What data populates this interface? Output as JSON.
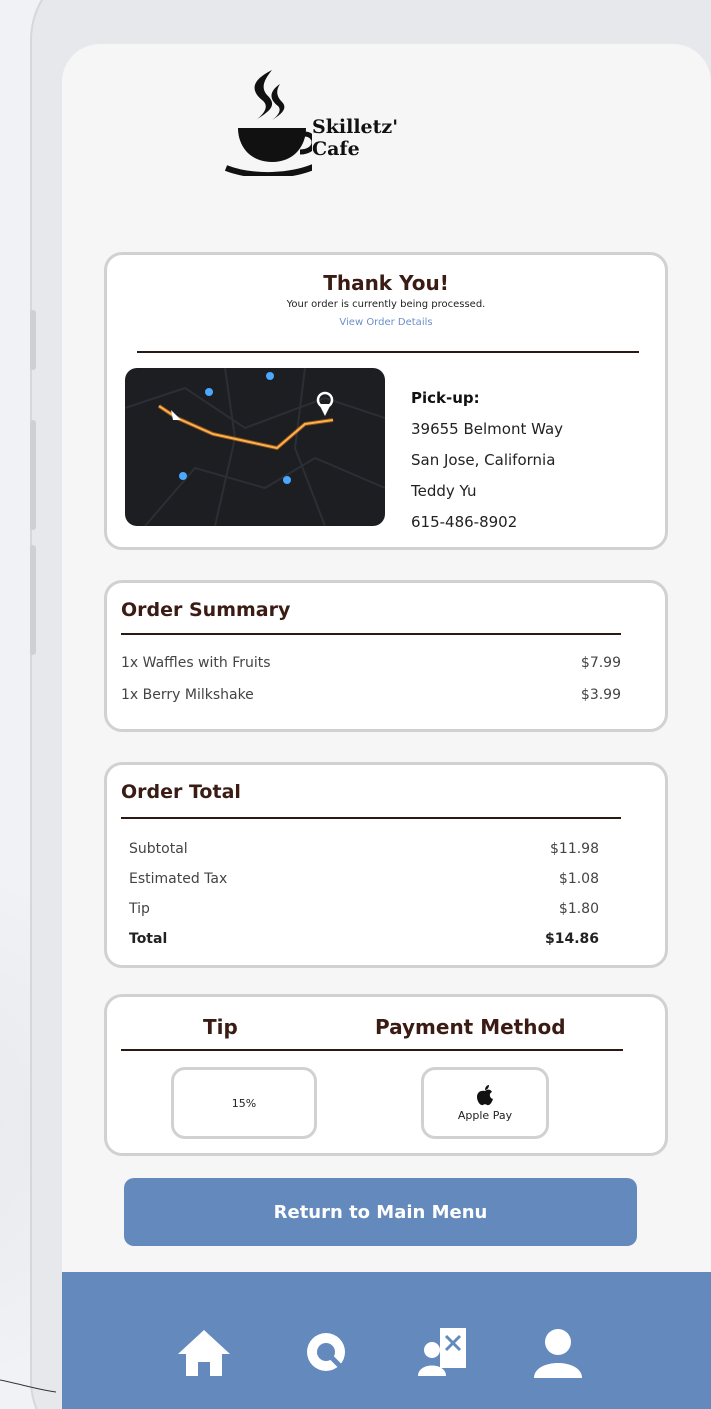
{
  "brand": {
    "line1": "Skilletz'",
    "line2": "Cafe"
  },
  "confirmation": {
    "title": "Thank You!",
    "subtitle": "Your order is currently being processed.",
    "link": "View Order Details"
  },
  "pickup": {
    "label": "Pick-up:",
    "address1": "39655 Belmont Way",
    "address2": "San Jose, California",
    "name": "Teddy Yu",
    "phone": "615-486-8902"
  },
  "order_summary": {
    "title": "Order Summary",
    "items": [
      {
        "name": "1x Waffles with Fruits",
        "price": "$7.99"
      },
      {
        "name": "1x Berry Milkshake",
        "price": "$3.99"
      }
    ]
  },
  "order_total": {
    "title": "Order Total",
    "rows": [
      {
        "label": "Subtotal",
        "value": "$11.98"
      },
      {
        "label": "Estimated Tax",
        "value": "$1.08"
      },
      {
        "label": "Tip",
        "value": "$1.80"
      },
      {
        "label": "Total",
        "value": "$14.86"
      }
    ]
  },
  "payment": {
    "tip_heading": "Tip",
    "method_heading": "Payment Method",
    "tip_value": "15%",
    "method_value": "Apple Pay"
  },
  "return_button": "Return to Main Menu",
  "nav": [
    "home-icon",
    "search-icon",
    "menu-board-icon",
    "profile-icon"
  ],
  "colors": {
    "accent": "#6489bd",
    "heading": "#3a1c14",
    "link": "#6b8fc8"
  }
}
